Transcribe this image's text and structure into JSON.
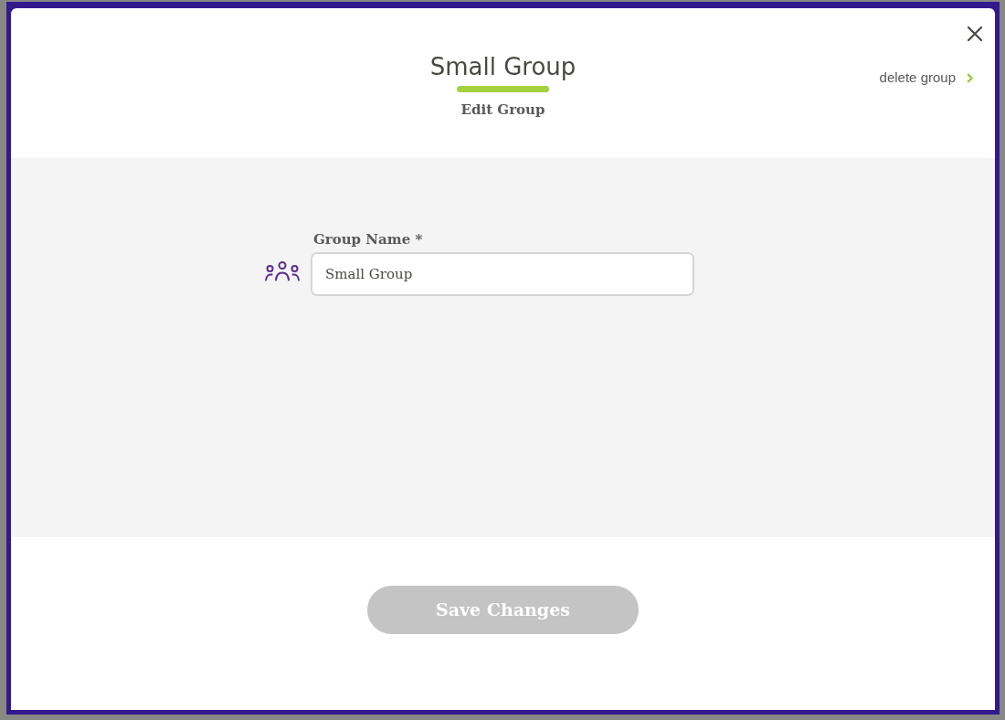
{
  "modal": {
    "title": "Small Group",
    "subtitle": "Edit Group",
    "delete_link": "delete group"
  },
  "form": {
    "fields": [
      {
        "label": "Group Name *",
        "value": "Small Group"
      }
    ]
  },
  "footer": {
    "save_button": {
      "label": "Save Changes",
      "disabled": true
    }
  }
}
